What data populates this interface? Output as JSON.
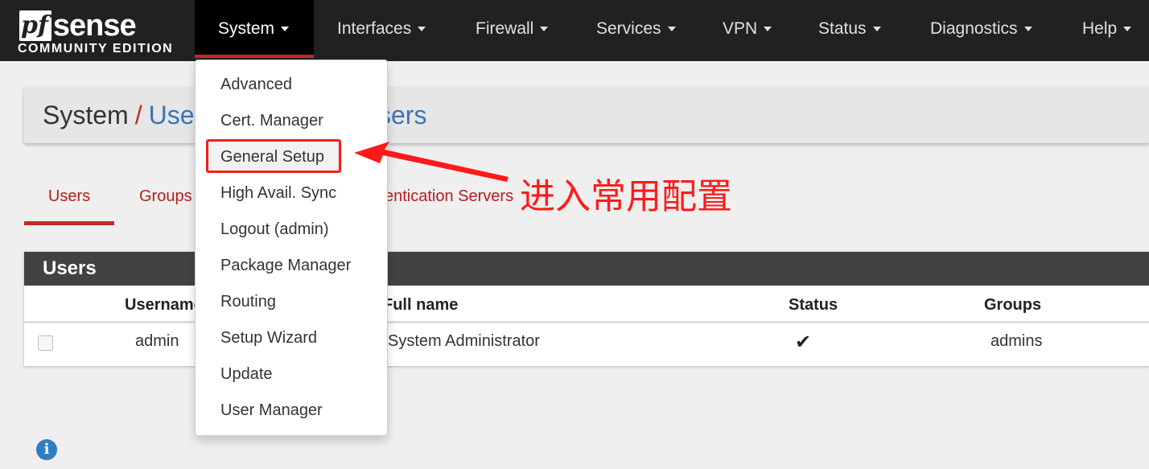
{
  "brand": {
    "logo_pf": "pf",
    "logo_sense": "sense",
    "edition": "COMMUNITY EDITION"
  },
  "nav": {
    "items": [
      {
        "label": "System"
      },
      {
        "label": "Interfaces"
      },
      {
        "label": "Firewall"
      },
      {
        "label": "Services"
      },
      {
        "label": "VPN"
      },
      {
        "label": "Status"
      },
      {
        "label": "Diagnostics"
      },
      {
        "label": "Help"
      }
    ]
  },
  "breadcrumb": {
    "root": "System",
    "separator": "/",
    "link_visible_start": "Use",
    "link_visible_end": "sers"
  },
  "tabs": [
    {
      "label": "Users"
    },
    {
      "label": "Groups"
    },
    {
      "label": "entication Servers"
    }
  ],
  "users_panel": {
    "title": "Users",
    "columns": [
      "Username",
      "Full name",
      "Status",
      "Groups"
    ],
    "rows": [
      {
        "username": "admin",
        "full_name": "System Administrator",
        "status_icon": "check-icon",
        "groups": "admins"
      }
    ]
  },
  "dropdown": {
    "items": [
      {
        "label": "Advanced"
      },
      {
        "label": "Cert. Manager"
      },
      {
        "label": "General Setup"
      },
      {
        "label": "High Avail. Sync"
      },
      {
        "label": "Logout (admin)"
      },
      {
        "label": "Package Manager"
      },
      {
        "label": "Routing"
      },
      {
        "label": "Setup Wizard"
      },
      {
        "label": "Update"
      },
      {
        "label": "User Manager"
      }
    ],
    "highlighted": "General Setup"
  },
  "annotation": {
    "text": "进入常用配置",
    "color": "#ff1a1a"
  },
  "colors": {
    "navbar": "#212121",
    "accent_red": "#c62828",
    "link_blue": "#3a74b8",
    "panel_header": "#424242"
  }
}
